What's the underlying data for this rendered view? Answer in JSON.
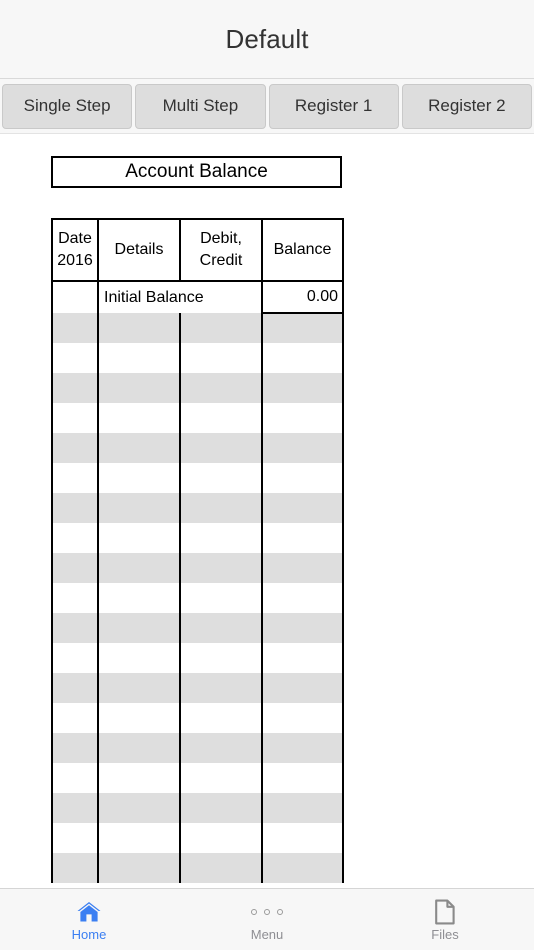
{
  "header": {
    "title": "Default"
  },
  "nav_buttons": [
    {
      "label": "Single Step",
      "name": "single-step"
    },
    {
      "label": "Multi Step",
      "name": "multi-step"
    },
    {
      "label": "Register 1",
      "name": "register-1"
    },
    {
      "label": "Register 2",
      "name": "register-2"
    }
  ],
  "panel": {
    "account_box_label": "Account Balance"
  },
  "table": {
    "headers": {
      "date_line1": "Date",
      "date_line2": "2016",
      "details": "Details",
      "debit_line1": "Debit,",
      "debit_line2": "Credit",
      "balance": "Balance"
    },
    "initial_row": {
      "date": "",
      "details": "Initial Balance",
      "balance": "0.00"
    },
    "empty_row_count": 19
  },
  "tabbar": {
    "items": [
      {
        "label": "Home",
        "icon": "home-icon",
        "active": true
      },
      {
        "label": "Menu",
        "icon": "menu-dots-icon",
        "active": false
      },
      {
        "label": "Files",
        "icon": "files-document-icon",
        "active": false
      }
    ]
  },
  "colors": {
    "accent": "#3b7ff2",
    "tab_inactive": "#8e8e93",
    "chrome_bg": "#f7f7f7",
    "button_bg": "#dddddd",
    "row_shaded": "#dedede",
    "table_border": "#000000"
  }
}
